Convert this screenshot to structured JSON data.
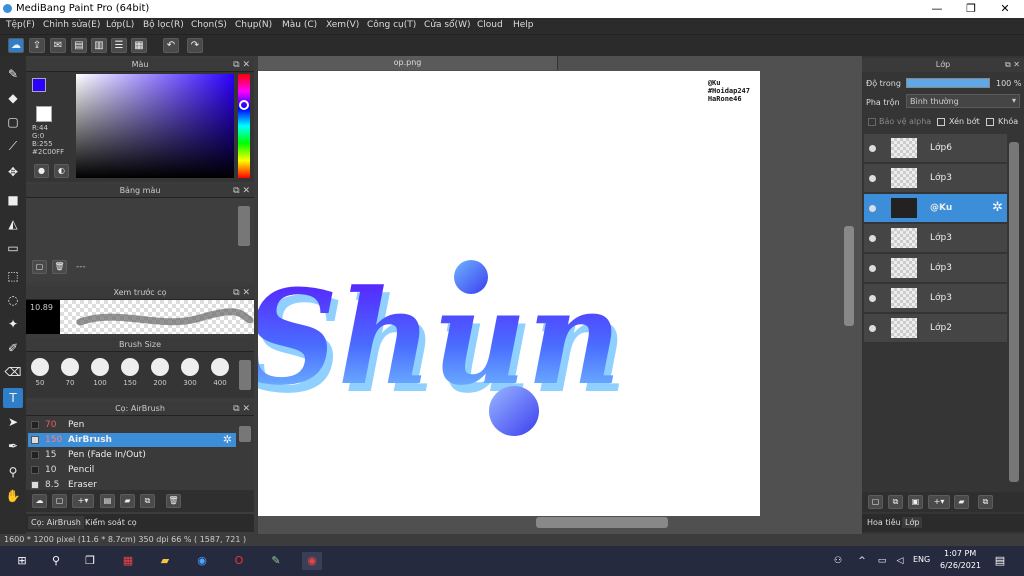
{
  "app": {
    "title": "MediBang Paint Pro (64bit)"
  },
  "window": {
    "minimize": "—",
    "maximize": "❐",
    "close": "✕"
  },
  "menu": [
    "Tệp(F)",
    "Chỉnh sửa(E)",
    "Lớp(L)",
    "Bộ lọc(R)",
    "Chọn(S)",
    "Chụp(N)",
    "Màu (C)",
    "Xem(V)",
    "Công cụ(T)",
    "Cửa sổ(W)",
    "Cloud",
    "Help"
  ],
  "color_panel": {
    "title": "Màu",
    "r": "R:44",
    "g": "G:0",
    "b": "B:255",
    "hex": "#2C00FF",
    "primary": "#2c00ff"
  },
  "palette_panel": {
    "title": "Bảng màu",
    "dash": "---"
  },
  "brush_preview": {
    "title": "Xem trước cọ",
    "size": "10.89"
  },
  "brush_size": {
    "title": "Brush Size",
    "sizes": [
      "50",
      "70",
      "100",
      "150",
      "200",
      "300",
      "400"
    ]
  },
  "brush_panel": {
    "title": "Cọ: AirBrush",
    "items": [
      {
        "size": "70",
        "name": "Pen"
      },
      {
        "size": "150",
        "name": "AirBrush"
      },
      {
        "size": "15",
        "name": "Pen (Fade In/Out)"
      },
      {
        "size": "10",
        "name": "Pencil"
      },
      {
        "size": "8.5",
        "name": "Eraser"
      }
    ]
  },
  "bottom_tabs": {
    "tab1": "Cọ: AirBrush",
    "tab2": "Kiểm soát cọ"
  },
  "document": {
    "tab": "op.png",
    "watermark": [
      "@Ku",
      "#Hoidap247",
      "HaRone46"
    ],
    "artwork_text": "Shun"
  },
  "layers_panel": {
    "title": "Lớp",
    "opacity_label": "Độ trong",
    "opacity_value": "100 %",
    "blend_label": "Pha trộn",
    "blend_value": "Bình thường",
    "protect_alpha": "Bảo vệ alpha",
    "clipping": "Xén bớt",
    "lock": "Khóa",
    "layers": [
      "Lớp6",
      "Lớp3",
      "@Ku",
      "Lớp3",
      "Lớp3",
      "Lớp3",
      "Lớp2"
    ],
    "selected_index": 2,
    "tab1": "Hoa tiêu",
    "tab2": "Lớp"
  },
  "status_bar": {
    "text": "1600 * 1200 pixel   (11.6 * 8.7cm)   350 dpi   66 %   ( 1587, 721 )"
  },
  "taskbar": {
    "lang": "ENG",
    "time": "1:07 PM",
    "date": "6/26/2021"
  }
}
